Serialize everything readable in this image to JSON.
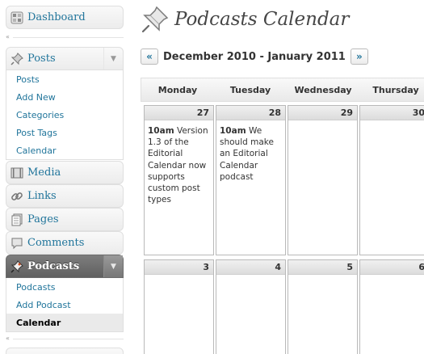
{
  "sidebar": {
    "dashboard": {
      "label": "Dashboard",
      "icon": "dashboard-icon"
    },
    "posts": {
      "label": "Posts",
      "icon": "pushpin-icon",
      "items": [
        {
          "label": "Posts"
        },
        {
          "label": "Add New"
        },
        {
          "label": "Categories"
        },
        {
          "label": "Post Tags"
        },
        {
          "label": "Calendar"
        }
      ]
    },
    "media": {
      "label": "Media",
      "icon": "media-icon"
    },
    "links": {
      "label": "Links",
      "icon": "links-icon"
    },
    "pages": {
      "label": "Pages",
      "icon": "pages-icon"
    },
    "comments": {
      "label": "Comments",
      "icon": "comments-icon"
    },
    "podcasts": {
      "label": "Podcasts",
      "icon": "pushpin-icon",
      "items": [
        {
          "label": "Podcasts"
        },
        {
          "label": "Add Podcast"
        },
        {
          "label": "Calendar",
          "current": true
        }
      ]
    }
  },
  "page": {
    "title": "Podcasts Calendar",
    "prev": "«",
    "next": "»",
    "date_range": "December 2010 - January 2011"
  },
  "calendar": {
    "days_of_week": [
      "Monday",
      "Tuesday",
      "Wednesday",
      "Thursday"
    ],
    "week1": [
      {
        "day": "27",
        "time": "10am",
        "text": "Version 1.3 of the Editorial Calendar now supports custom post types"
      },
      {
        "day": "28",
        "time": "10am",
        "text": "We should make an Editorial Calendar podcast"
      },
      {
        "day": "29"
      },
      {
        "day": "30"
      }
    ],
    "week2": [
      {
        "day": "3"
      },
      {
        "day": "4"
      },
      {
        "day": "5"
      },
      {
        "day": "6"
      }
    ]
  },
  "colors": {
    "link": "#21759b",
    "current_menu": "#6d6d6d"
  }
}
